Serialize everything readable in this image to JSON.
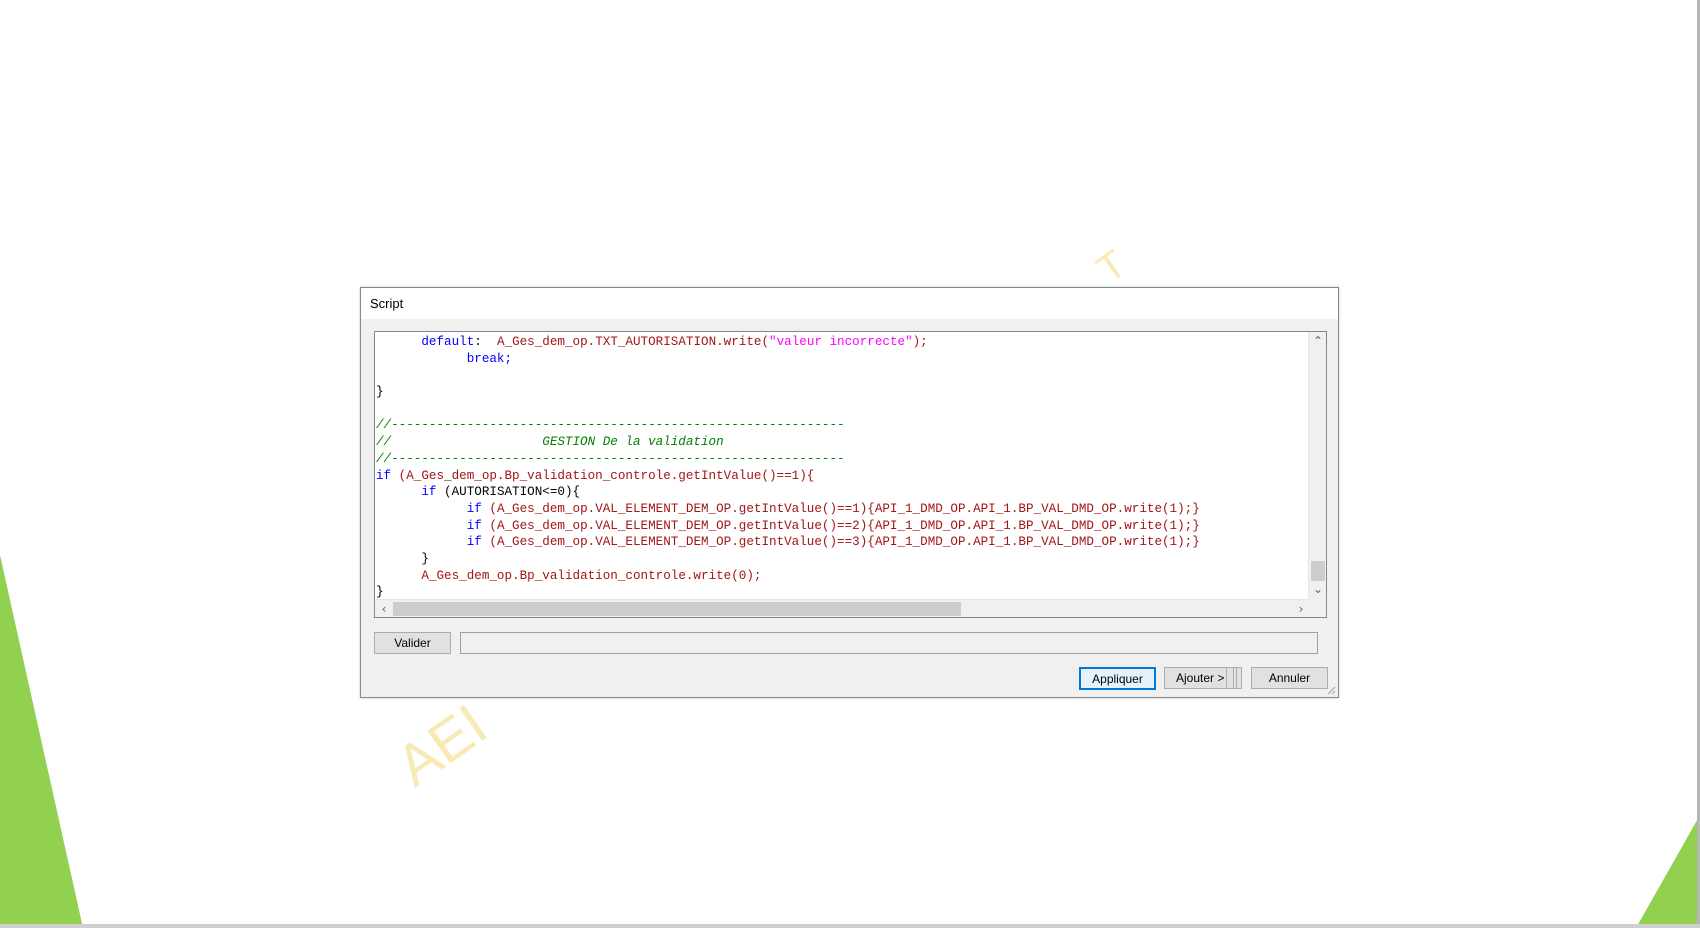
{
  "background": {
    "accent_color": "#92d050",
    "watermark_text": "AEI"
  },
  "dialog": {
    "title": "Script",
    "code_lines": [
      [
        {
          "t": "      ",
          "c": "pn"
        },
        {
          "t": "default",
          "c": "kw"
        },
        {
          "t": ":  ",
          "c": "pn"
        },
        {
          "t": "A_Ges_dem_op.TXT_AUTORISATION.write(",
          "c": "id"
        },
        {
          "t": "\"valeur incorrecte\"",
          "c": "str"
        },
        {
          "t": ");",
          "c": "id"
        }
      ],
      [
        {
          "t": "            ",
          "c": "pn"
        },
        {
          "t": "break;",
          "c": "kw"
        }
      ],
      [],
      [
        {
          "t": "}",
          "c": "pn"
        }
      ],
      [],
      [
        {
          "t": "//------------------------------------------------------------",
          "c": "cm"
        }
      ],
      [
        {
          "t": "//                    GESTION De la validation",
          "c": "cm"
        }
      ],
      [
        {
          "t": "//------------------------------------------------------------",
          "c": "cm"
        }
      ],
      [
        {
          "t": "if",
          "c": "kw"
        },
        {
          "t": " (A_Ges_dem_op.Bp_validation_controle.getIntValue()==1){",
          "c": "id"
        }
      ],
      [
        {
          "t": "      ",
          "c": "pn"
        },
        {
          "t": "if",
          "c": "kw"
        },
        {
          "t": " (AUTORISATION<=0){",
          "c": "pn"
        }
      ],
      [
        {
          "t": "            ",
          "c": "pn"
        },
        {
          "t": "if",
          "c": "kw"
        },
        {
          "t": " (A_Ges_dem_op.VAL_ELEMENT_DEM_OP.getIntValue()==1){API_1_DMD_OP.API_1.BP_VAL_DMD_OP.write(1);}",
          "c": "id"
        }
      ],
      [
        {
          "t": "            ",
          "c": "pn"
        },
        {
          "t": "if",
          "c": "kw"
        },
        {
          "t": " (A_Ges_dem_op.VAL_ELEMENT_DEM_OP.getIntValue()==2){API_1_DMD_OP.API_1.BP_VAL_DMD_OP.write(1);}",
          "c": "id"
        }
      ],
      [
        {
          "t": "            ",
          "c": "pn"
        },
        {
          "t": "if",
          "c": "kw"
        },
        {
          "t": " (A_Ges_dem_op.VAL_ELEMENT_DEM_OP.getIntValue()==3){API_1_DMD_OP.API_1.BP_VAL_DMD_OP.write(1);}",
          "c": "id"
        }
      ],
      [
        {
          "t": "      }",
          "c": "pn"
        }
      ],
      [
        {
          "t": "      ",
          "c": "pn"
        },
        {
          "t": "A_Ges_dem_op.Bp_validation_controle.write(0);",
          "c": "id"
        }
      ],
      [
        {
          "t": "}",
          "c": "pn"
        }
      ]
    ],
    "buttons": {
      "valider": "Valider",
      "appliquer": "Appliquer",
      "ajouter": "Ajouter >",
      "annuler": "Annuler"
    },
    "message_field_value": "",
    "scroll": {
      "vertical_position": 0.92,
      "horizontal_thumb_fraction": 0.62
    }
  }
}
